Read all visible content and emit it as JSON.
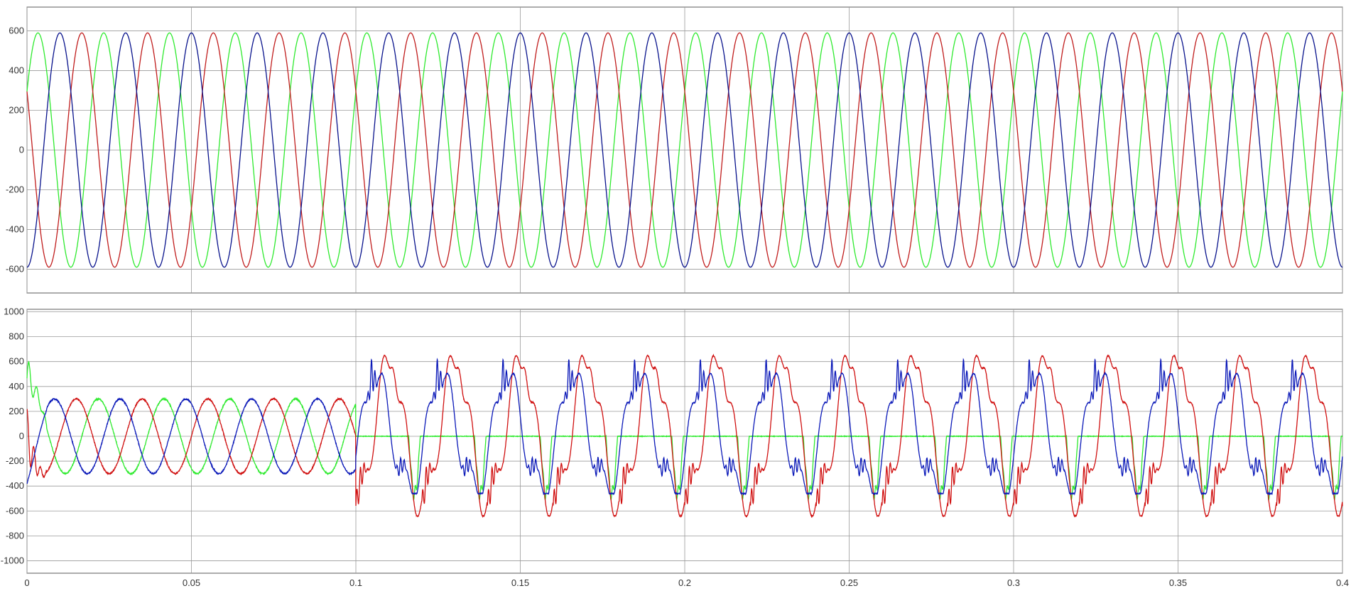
{
  "chart_data": [
    {
      "type": "line",
      "title": "",
      "xlabel": "",
      "ylabel": "",
      "xlim": [
        0,
        0.4
      ],
      "ylim": [
        -720,
        720
      ],
      "grid": true,
      "legend": "none",
      "x_ticks": [
        "0",
        "0.05",
        "0.1",
        "0.15",
        "0.2",
        "0.25",
        "0.3",
        "0.35",
        "0.4"
      ],
      "y_ticks": [
        "600",
        "400",
        "200",
        "0",
        "-200",
        "-400",
        "-600"
      ],
      "frequency_hz": 50,
      "amplitude": 590,
      "series": [
        {
          "color": "#2eea2e",
          "model": "sine",
          "phase_deg": 30
        },
        {
          "color": "#c01c1c",
          "model": "sine",
          "phase_deg": 150
        },
        {
          "color": "#08128c",
          "model": "sine",
          "phase_deg": -90
        }
      ]
    },
    {
      "type": "line",
      "title": "",
      "xlabel": "",
      "ylabel": "",
      "xlim": [
        0,
        0.4
      ],
      "ylim": [
        -1100,
        1020
      ],
      "grid": true,
      "legend": "none",
      "x_ticks": [
        "0",
        "0.05",
        "0.1",
        "0.15",
        "0.2",
        "0.25",
        "0.3",
        "0.35",
        "0.4"
      ],
      "y_ticks": [
        "1000",
        "800",
        "600",
        "400",
        "200",
        "0",
        "-200",
        "-400",
        "-600",
        "-800",
        "-1000"
      ],
      "frequency_hz": 50,
      "event_time": 0.1,
      "series": [
        {
          "color": "#2eea2e",
          "pre_event_amplitude": 300,
          "pre_event_phase_deg": 60,
          "post_event_level": 0,
          "post_event_dip_min": -550
        },
        {
          "color": "#d01010",
          "pre_event_amplitude": 300,
          "pre_event_phase_deg": 180,
          "post_event_peak": 700,
          "post_event_min": -640
        },
        {
          "color": "#0a18b8",
          "pre_event_amplitude": 300,
          "pre_event_phase_deg": -60,
          "post_event_peak": 800,
          "post_event_min": -460
        }
      ]
    }
  ]
}
